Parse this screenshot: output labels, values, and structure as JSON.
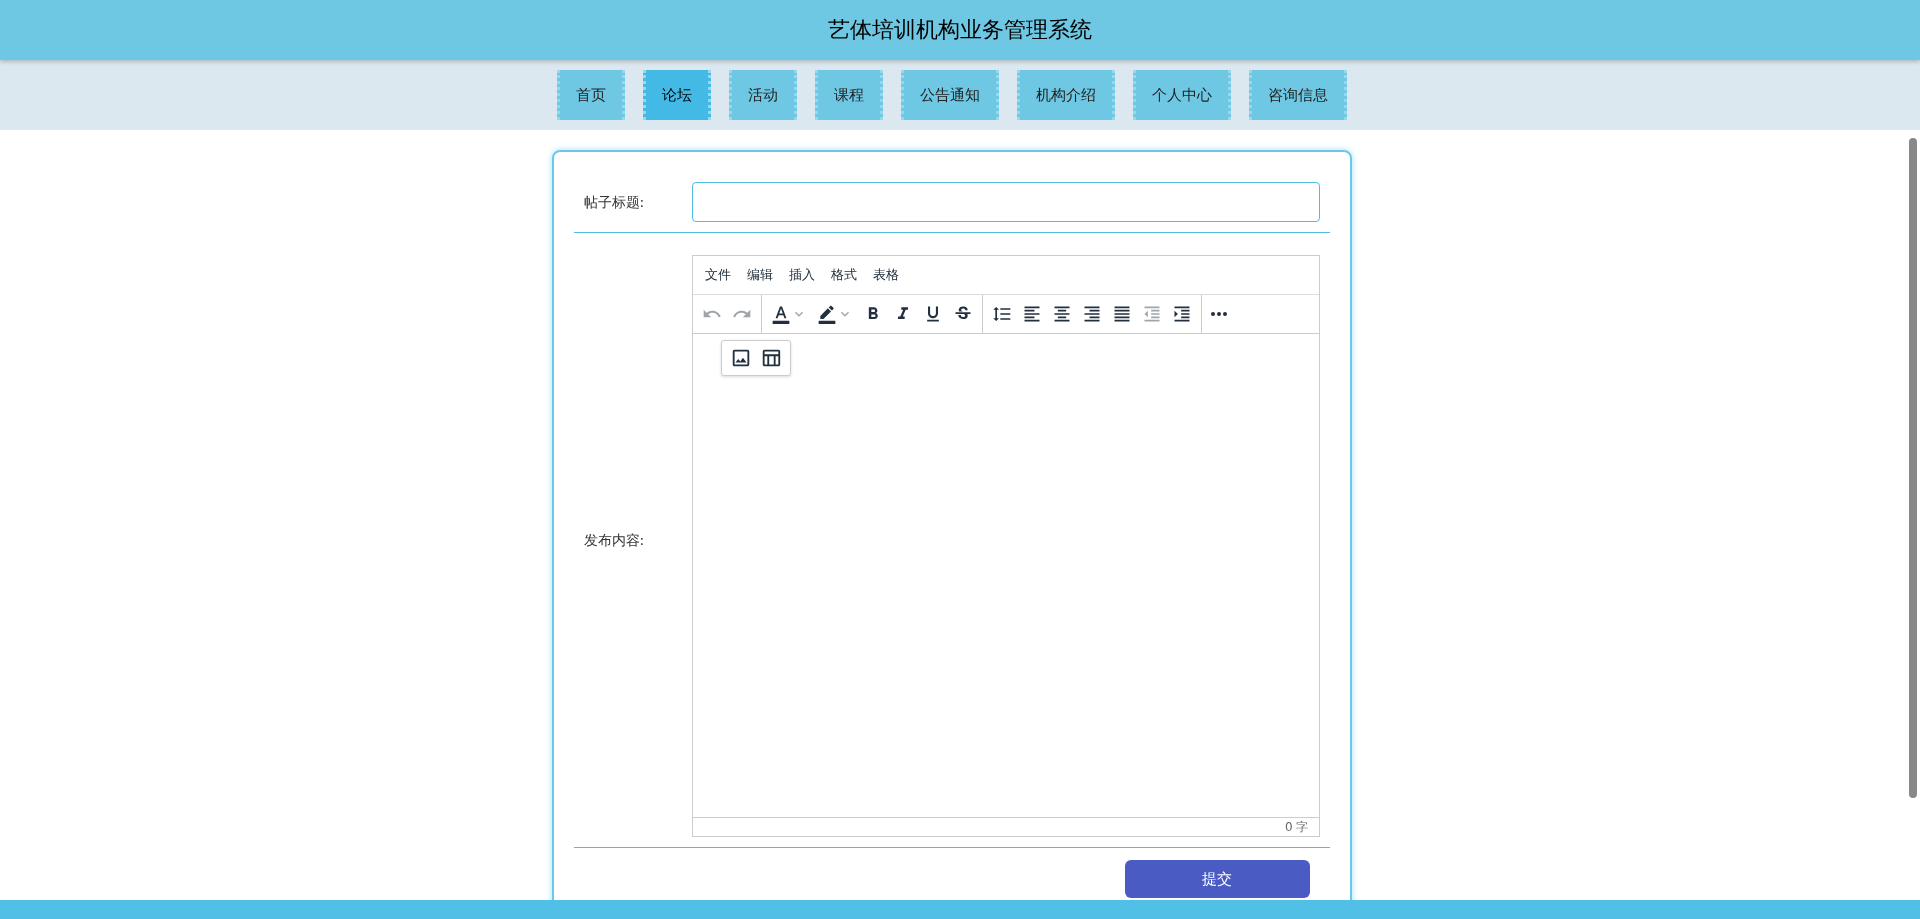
{
  "header": {
    "title": "艺体培训机构业务管理系统"
  },
  "nav": [
    {
      "label": "首页",
      "selected": false
    },
    {
      "label": "论坛",
      "selected": true
    },
    {
      "label": "活动",
      "selected": false
    },
    {
      "label": "课程",
      "selected": false
    },
    {
      "label": "公告通知",
      "selected": false
    },
    {
      "label": "机构介绍",
      "selected": false
    },
    {
      "label": "个人中心",
      "selected": false
    },
    {
      "label": "咨询信息",
      "selected": false
    }
  ],
  "form": {
    "title_label": "帖子标题:",
    "content_label": "发布内容:",
    "editor": {
      "menu": [
        "文件",
        "编辑",
        "插入",
        "格式",
        "表格"
      ],
      "toolbar": [
        [
          {
            "kind": "undo",
            "disabled": true
          },
          {
            "kind": "redo",
            "disabled": true
          }
        ],
        [
          {
            "kind": "text-color",
            "disabled": false
          },
          {
            "kind": "highlight",
            "disabled": false
          },
          {
            "kind": "bold",
            "disabled": false
          },
          {
            "kind": "italic",
            "disabled": false
          },
          {
            "kind": "underline",
            "disabled": false
          },
          {
            "kind": "strike",
            "disabled": false
          }
        ],
        [
          {
            "kind": "line-height",
            "disabled": false
          },
          {
            "kind": "align-left",
            "disabled": false
          },
          {
            "kind": "align-center",
            "disabled": false
          },
          {
            "kind": "align-right",
            "disabled": false
          },
          {
            "kind": "justify",
            "disabled": false
          },
          {
            "kind": "outdent",
            "disabled": true
          },
          {
            "kind": "indent",
            "disabled": false
          }
        ],
        [
          {
            "kind": "more",
            "disabled": false
          }
        ]
      ],
      "quickbar": [
        {
          "kind": "image"
        },
        {
          "kind": "table"
        }
      ],
      "word_count": "0 字"
    },
    "submit": "提交"
  }
}
